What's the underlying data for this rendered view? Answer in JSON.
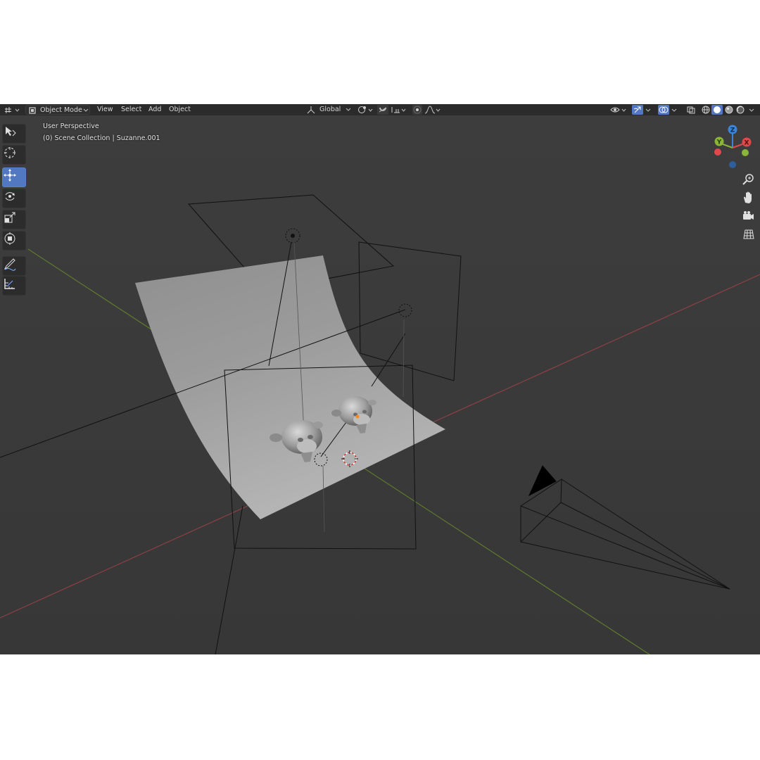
{
  "header": {
    "editor_type_icon": "grid-editor-icon",
    "mode_label": "Object Mode",
    "menus": [
      "View",
      "Select",
      "Add",
      "Object"
    ],
    "transform_orientation": "Global"
  },
  "viewport": {
    "view_name": "User Perspective",
    "collection_info": "(0) Scene Collection | Suzanne.001"
  },
  "toolbar": {
    "tools": [
      "cursor-select-icon",
      "3d-cursor-icon",
      "move-icon",
      "rotate-icon",
      "scale-icon",
      "transform-icon",
      "annotate-icon",
      "measure-icon"
    ],
    "active_tool": "move-icon"
  },
  "gizmo": {
    "axes": [
      "X",
      "Y",
      "Z"
    ],
    "colors": {
      "x": "#e2484b",
      "y": "#8ab539",
      "z": "#3b85d9"
    }
  },
  "navigation": [
    "zoom-icon",
    "hand-pan-icon",
    "camera-view-icon",
    "grid-ortho-icon"
  ],
  "colors": {
    "viewport_bg": "#3a3a3a",
    "header_bg": "#2b2b2b",
    "accent": "#5178c1",
    "x_axis": "#8d4146",
    "y_axis": "#5f7a2f"
  }
}
